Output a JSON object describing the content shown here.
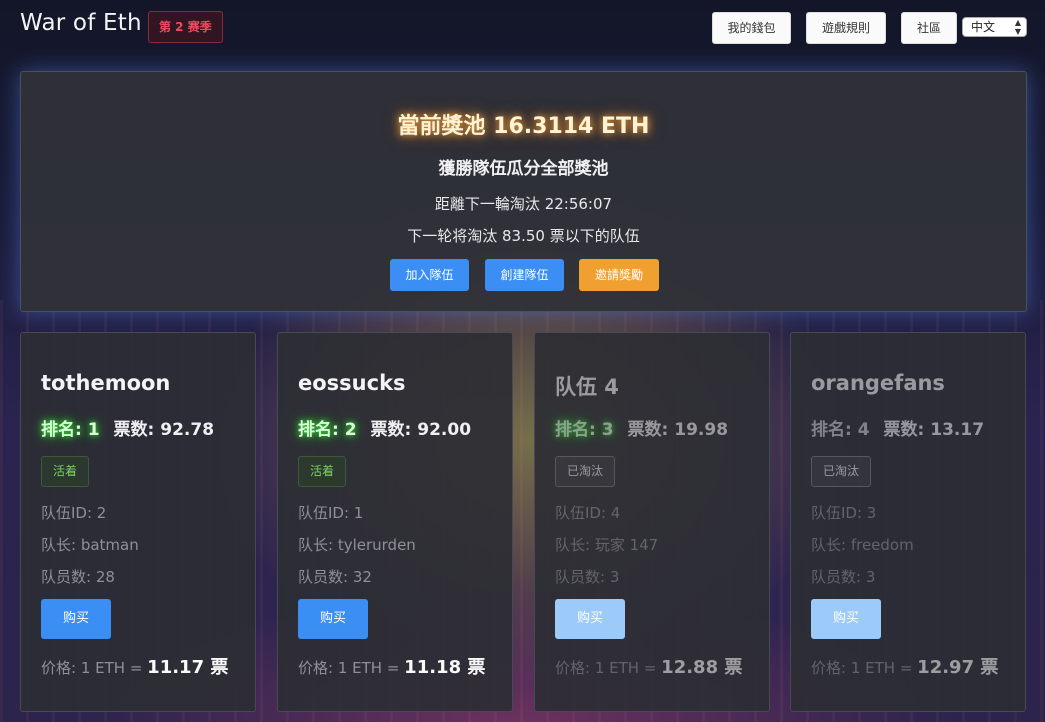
{
  "header": {
    "brand": "War of Eth",
    "season": "第 2 赛季",
    "nav": [
      "我的錢包",
      "遊戲規則",
      "社區"
    ],
    "language": "中文"
  },
  "hero": {
    "pool": "當前獎池 16.3114 ETH",
    "subtitle": "獲勝隊伍瓜分全部獎池",
    "countdown": "距離下一輪淘汰 22:56:07",
    "threshold": "下一轮将淘汰 83.50 票以下的队伍",
    "buttons": [
      "加入隊伍",
      "創建隊伍",
      "邀請獎勵"
    ]
  },
  "colors": {
    "primary": "#3a8ef4",
    "accent": "#f0a030",
    "alive": "#7ccf5a"
  },
  "teams": [
    {
      "name": "tothemoon",
      "rank": "排名: 1",
      "votes": "票数: 92.78",
      "status": "活着",
      "id": "队伍ID: 2",
      "leader": "队长: batman",
      "members": "队员数: 28",
      "buy": "购买",
      "price_prefix": "价格: 1 ETH =",
      "price_value": "11.17 票"
    },
    {
      "name": "eossucks",
      "rank": "排名: 2",
      "votes": "票数: 92.00",
      "status": "活着",
      "id": "队伍ID: 1",
      "leader": "队长: tylerurden",
      "members": "队员数: 32",
      "buy": "购买",
      "price_prefix": "价格: 1 ETH =",
      "price_value": "11.18 票"
    },
    {
      "name": "队伍 4",
      "rank": "排名: 3",
      "votes": "票数: 19.98",
      "status": "已淘汰",
      "id": "队伍ID: 4",
      "leader": "队长: 玩家 147",
      "members": "队员数: 3",
      "buy": "购买",
      "price_prefix": "价格: 1 ETH =",
      "price_value": "12.88 票"
    },
    {
      "name": "orangefans",
      "rank": "排名: 4",
      "votes": "票数: 13.17",
      "status": "已淘汰",
      "id": "队伍ID: 3",
      "leader": "队长: freedom",
      "members": "队员数: 3",
      "buy": "购买",
      "price_prefix": "价格: 1 ETH =",
      "price_value": "12.97 票"
    }
  ]
}
